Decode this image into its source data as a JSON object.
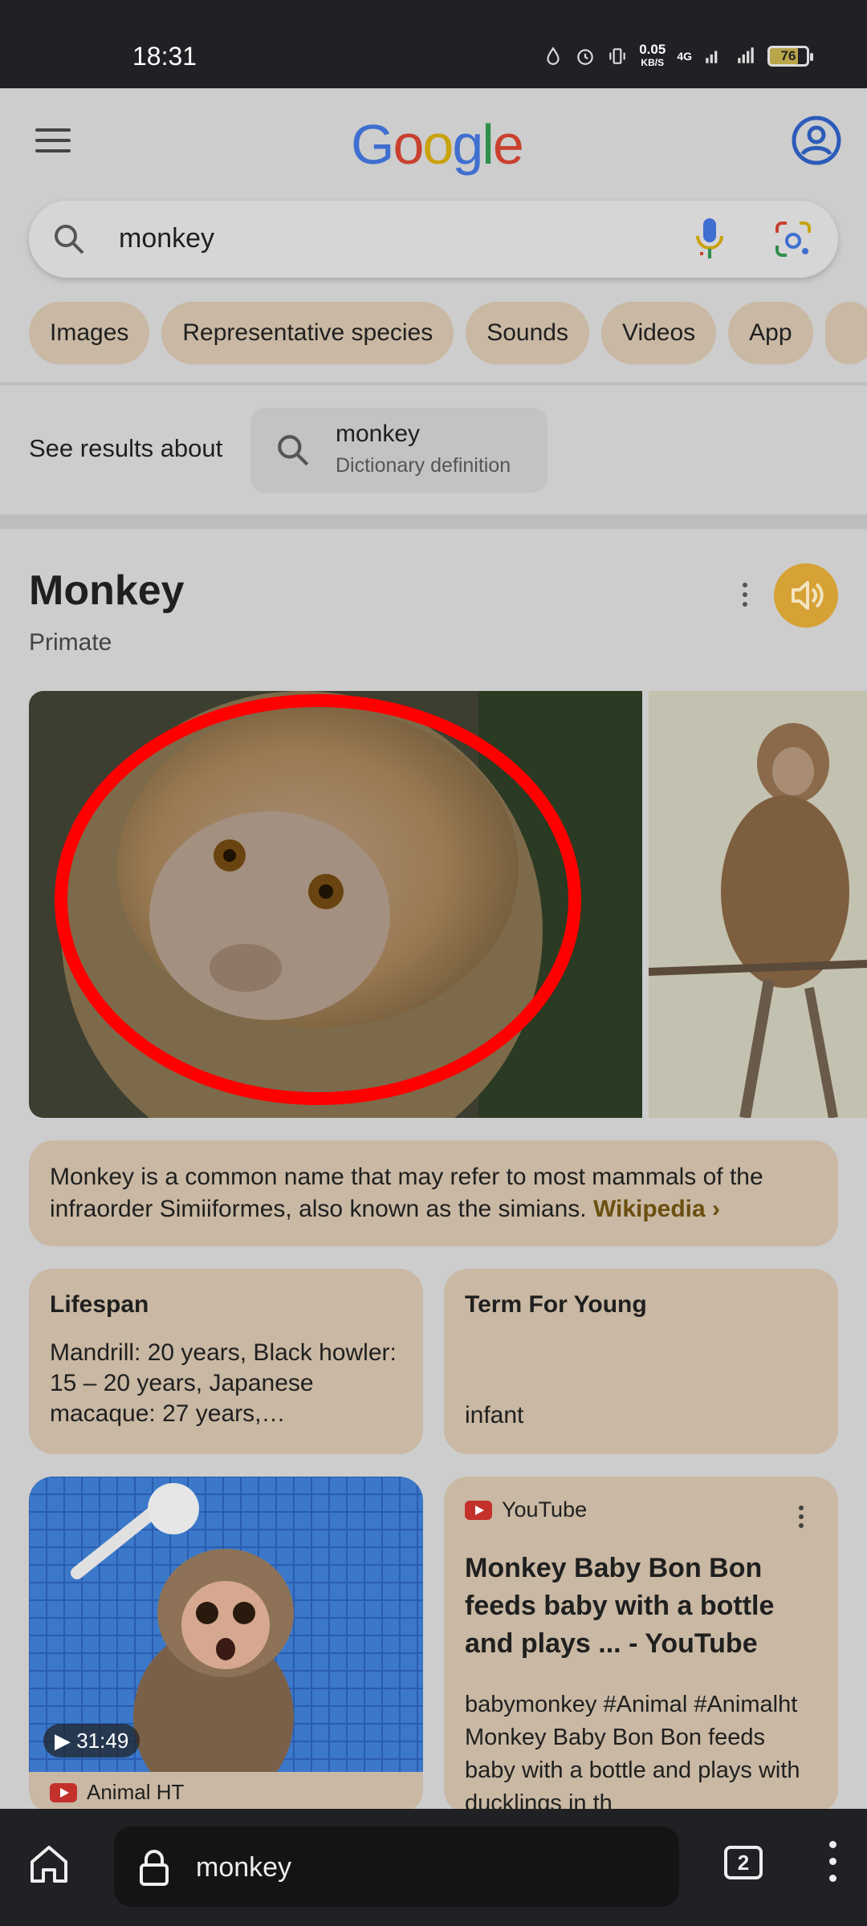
{
  "status_bar": {
    "time": "18:31",
    "net_speed": "0.05",
    "net_unit": "KB/S",
    "network": "4G",
    "battery": "76"
  },
  "header": {
    "logo_letters": [
      "G",
      "o",
      "o",
      "g",
      "l",
      "e"
    ]
  },
  "search": {
    "query": "monkey"
  },
  "chips": [
    "Images",
    "Representative species",
    "Sounds",
    "Videos",
    "App"
  ],
  "see_results": {
    "label": "See results about",
    "card_title": "monkey",
    "card_subtitle": "Dictionary definition"
  },
  "knowledge_panel": {
    "title": "Monkey",
    "subtitle": "Primate",
    "description": "Monkey is a common name that may refer to most mammals of the infraorder Simiiformes, also known as the simians.",
    "source_link": "Wikipedia ›",
    "facts": [
      {
        "label": "Lifespan",
        "value": "Mandrill: 20 years, Black howler: 15 – 20 years, Japanese macaque: 27 years,…"
      },
      {
        "label": "Term For Young",
        "value": "infant"
      }
    ]
  },
  "video": {
    "duration": "31:49",
    "channel": "Animal HT"
  },
  "youtube_card": {
    "source": "YouTube",
    "title": "Monkey Baby Bon Bon feeds baby with a bottle and plays ... - YouTube",
    "description": "babymonkey #Animal #Animalht Monkey Baby Bon Bon feeds baby with a bottle and plays with ducklings in th"
  },
  "bottom_bar": {
    "url": "monkey",
    "tab_count": "2"
  },
  "colors": {
    "chip_bg": "#c9b8a3",
    "speaker_accent": "#d6a135",
    "annotation_circle": "#ff0000",
    "link_brown": "#6b4f10"
  }
}
